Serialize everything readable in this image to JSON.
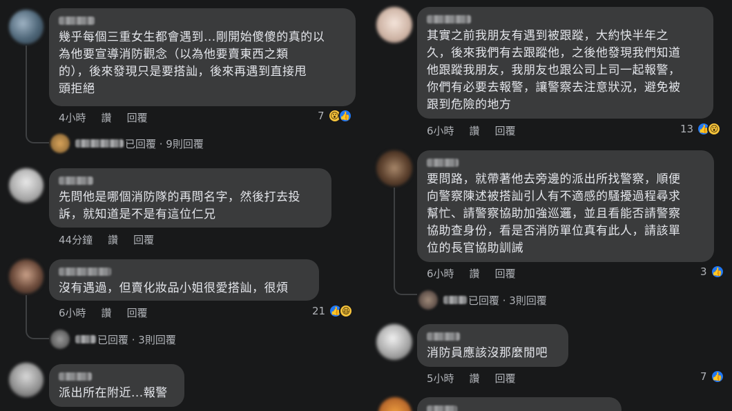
{
  "left": [
    {
      "text": "幾乎每個三重女生都會遇到...剛開始傻傻的真的以\n為他要宣導消防觀念（以為他要賣東西之類\n的），後來發現只是要搭訕，後來再遇到直接甩\n頭拒絕",
      "time": "4小時",
      "read": "讚",
      "reply": "回覆",
      "reaction_count": "7",
      "reactions": [
        "wow-icon",
        "like-icon"
      ],
      "replies_text": "已回覆 · 9則回覆"
    },
    {
      "text": "先問他是哪個消防隊的再問名字，然後打去投\n訴，就知道是不是有這位仁兄",
      "time": "44分鐘",
      "read": "讚",
      "reply": "回覆"
    },
    {
      "text": "沒有遇過，但賣化妝品小姐很愛搭訕，很煩",
      "time": "6小時",
      "read": "讚",
      "reply": "回覆",
      "reaction_count": "21",
      "reactions": [
        "like-icon",
        "haha-icon"
      ],
      "replies_text": "已回覆 · 3則回覆"
    },
    {
      "text": "派出所在附近...報警"
    }
  ],
  "right": [
    {
      "text": "其實之前我朋友有遇到被跟蹤，大約快半年之\n久，後來我們有去跟蹤他，之後他發現我們知道\n他跟蹤我朋友，我朋友也跟公司上司一起報警，\n你們有必要去報警，讓警察去注意狀況，避免被\n跟到危險的地方",
      "time": "6小時",
      "read": "讚",
      "reply": "回覆",
      "reaction_count": "13",
      "reactions": [
        "like-icon",
        "wow-icon"
      ]
    },
    {
      "text": "要問路，就帶著他去旁邊的派出所找警察，順便\n向警察陳述被搭訕引人有不適感的騷擾過程尋求\n幫忙、請警察協助加強巡邏，並且看能否請警察\n協助查身份，看是否消防單位真有此人，請該單\n位的長官協助訓誡",
      "time": "6小時",
      "read": "讚",
      "reply": "回覆",
      "reaction_count": "3",
      "reactions": [
        "like-icon"
      ],
      "replies_text": "已回覆 · 3則回覆"
    },
    {
      "text": "消防員應該沒那麼閒吧",
      "time": "5小時",
      "read": "讚",
      "reply": "回覆",
      "reaction_count": "7",
      "reactions": [
        "like-icon"
      ]
    }
  ],
  "colors": {
    "background": "#18191a",
    "bubble": "#3a3b3c",
    "like": "#2078f4",
    "wow": "#f7c43c",
    "meta_text": "#b0b3b8"
  }
}
